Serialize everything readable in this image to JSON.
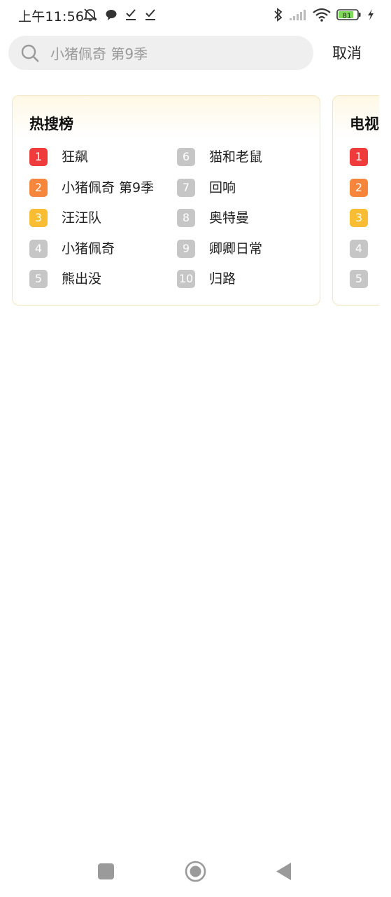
{
  "status_bar": {
    "time": "上午11:56",
    "battery": "81",
    "left_icons": [
      "bell-off-icon",
      "chat-bubble-icon",
      "download-check-icon",
      "download-check-icon"
    ],
    "right_icons": [
      "bluetooth-icon",
      "signal-icon",
      "wifi-icon",
      "battery-icon",
      "charging-bolt-icon"
    ]
  },
  "search": {
    "placeholder": "小猪佩奇 第9季",
    "value": "",
    "cancel_label": "取消"
  },
  "colors": {
    "rank_1": "#ef3b3b",
    "rank_2": "#f5863b",
    "rank_3": "#f9bd33",
    "rank_other": "#c6c6c6",
    "card_border": "#f3e6bf",
    "card_top": "#fff8e6"
  },
  "hot_search": {
    "title": "热搜榜",
    "items": [
      {
        "rank": "1",
        "label": "狂飙"
      },
      {
        "rank": "2",
        "label": "小猪佩奇 第9季"
      },
      {
        "rank": "3",
        "label": "汪汪队"
      },
      {
        "rank": "4",
        "label": "小猪佩奇"
      },
      {
        "rank": "5",
        "label": "熊出没"
      },
      {
        "rank": "6",
        "label": "猫和老鼠"
      },
      {
        "rank": "7",
        "label": "回响"
      },
      {
        "rank": "8",
        "label": "奥特曼"
      },
      {
        "rank": "9",
        "label": "卿卿日常"
      },
      {
        "rank": "10",
        "label": "归路"
      }
    ]
  },
  "tv_ranking": {
    "title": "电视",
    "items": [
      {
        "rank": "1"
      },
      {
        "rank": "2"
      },
      {
        "rank": "3"
      },
      {
        "rank": "4"
      },
      {
        "rank": "5"
      }
    ]
  },
  "nav_bar": {
    "icons": [
      "recents-square-icon",
      "home-circle-icon",
      "back-triangle-icon"
    ]
  }
}
